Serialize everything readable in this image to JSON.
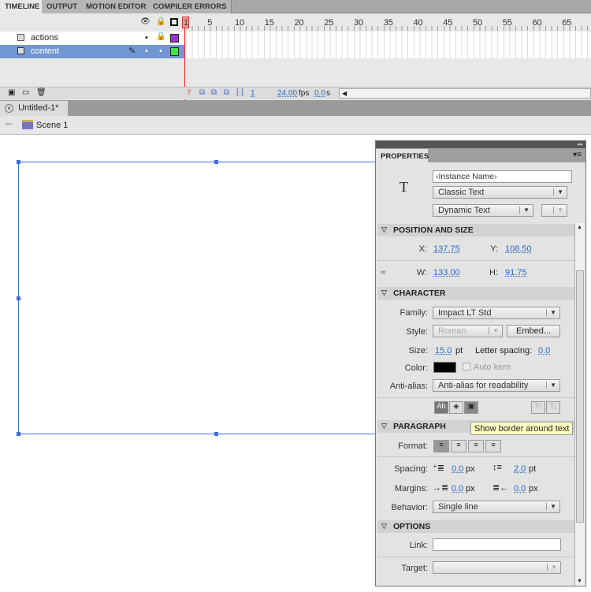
{
  "tabs": [
    "TIMELINE",
    "OUTPUT",
    "MOTION EDITOR",
    "COMPILER ERRORS"
  ],
  "frame_numbers": [
    "1",
    "5",
    "10",
    "15",
    "20",
    "25",
    "30",
    "35",
    "40",
    "45",
    "50",
    "55",
    "60",
    "65"
  ],
  "layers": [
    {
      "name": "actions",
      "color": "#9b30d0",
      "locked": true,
      "selected": false
    },
    {
      "name": "content",
      "color": "#3ee83e",
      "locked": false,
      "selected": true
    }
  ],
  "status": {
    "frame": "1",
    "fps": "24.00",
    "fps_unit": "fps",
    "time": "0.0",
    "time_unit": "s"
  },
  "document_tab": "Untitled-1*",
  "scene": "Scene 1",
  "properties": {
    "tab": "PROPERTIES",
    "instance_name_placeholder": "‹Instance Name›",
    "text_engine": "Classic Text",
    "text_type": "Dynamic Text",
    "position_header": "POSITION AND SIZE",
    "x_label": "X:",
    "x": "137.75",
    "y_label": "Y:",
    "y": "108.50",
    "w_label": "W:",
    "w": "133.00",
    "h_label": "H:",
    "h": "91.75",
    "character_header": "CHARACTER",
    "family_label": "Family:",
    "family": "Impact LT Std",
    "style_label": "Style:",
    "style": "Roman",
    "embed": "Embed...",
    "size_label": "Size:",
    "size": "15.0",
    "size_unit": "pt",
    "letter_spacing_label": "Letter spacing:",
    "letter_spacing": "0.0",
    "color_label": "Color:",
    "color": "#000000",
    "auto_kern": "Auto kern",
    "anti_alias_label": "Anti-alias:",
    "anti_alias": "Anti-alias for readability",
    "tooltip": "Show border around text",
    "paragraph_header": "PARAGRAPH",
    "format_label": "Format:",
    "spacing_label": "Spacing:",
    "indent": "0.0",
    "indent_unit": "px",
    "line_spacing": "2.0",
    "line_spacing_unit": "pt",
    "margins_label": "Margins:",
    "left_margin": "0.0",
    "left_margin_unit": "px",
    "right_margin": "0.0",
    "right_margin_unit": "px",
    "behavior_label": "Behavior:",
    "behavior": "Single line",
    "options_header": "OPTIONS",
    "link_label": "Link:",
    "link": "",
    "target_label": "Target:",
    "target": ""
  }
}
